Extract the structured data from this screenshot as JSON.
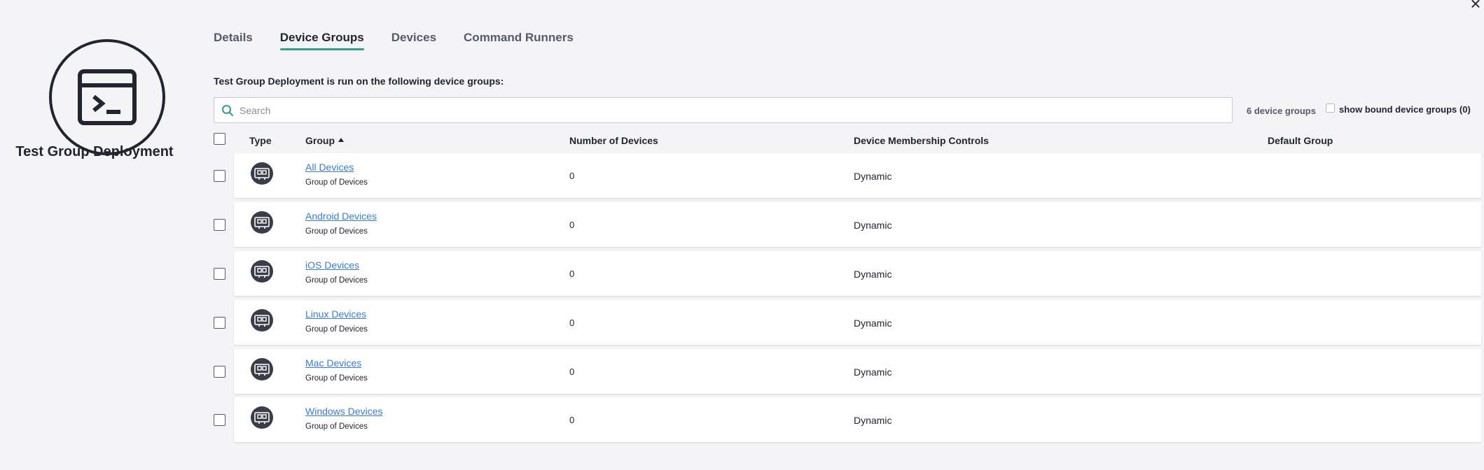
{
  "header": {
    "close_symbol": "×"
  },
  "config": {
    "title": "Test Group Deployment",
    "icon": "command-window-icon"
  },
  "tabs": [
    {
      "label": "Details",
      "active": false
    },
    {
      "label": "Device Groups",
      "active": true
    },
    {
      "label": "Devices",
      "active": false
    },
    {
      "label": "Command Runners",
      "active": false
    }
  ],
  "intro_text": "Test Group Deployment is run on the following device groups:",
  "search": {
    "placeholder": "Search",
    "value": ""
  },
  "group_count": "6 device groups",
  "bound_toggle_label": "show bound device groups (0)",
  "table": {
    "columns": {
      "type": "Type",
      "group": "Group",
      "num_devices": "Number of Devices",
      "membership": "Device Membership Controls",
      "default_group": "Default Group"
    },
    "rows": [
      {
        "name": "All Devices",
        "subtitle": "Group of Devices",
        "num_devices": "0",
        "membership": "Dynamic",
        "default_group": ""
      },
      {
        "name": "Android Devices",
        "subtitle": "Group of Devices",
        "num_devices": "0",
        "membership": "Dynamic",
        "default_group": ""
      },
      {
        "name": "iOS Devices",
        "subtitle": "Group of Devices",
        "num_devices": "0",
        "membership": "Dynamic",
        "default_group": ""
      },
      {
        "name": "Linux Devices",
        "subtitle": "Group of Devices",
        "num_devices": "0",
        "membership": "Dynamic",
        "default_group": ""
      },
      {
        "name": "Mac Devices",
        "subtitle": "Group of Devices",
        "num_devices": "0",
        "membership": "Dynamic",
        "default_group": ""
      },
      {
        "name": "Windows Devices",
        "subtitle": "Group of Devices",
        "num_devices": "0",
        "membership": "Dynamic",
        "default_group": ""
      }
    ]
  },
  "colors": {
    "accent": "#2f9e8f",
    "link": "#3a7bd5",
    "text": "#202530",
    "background": "#f4f4f6"
  }
}
